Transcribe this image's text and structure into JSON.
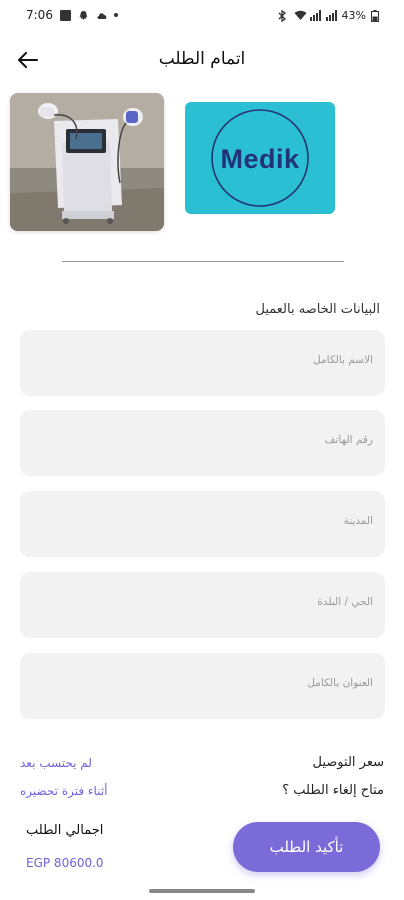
{
  "status_bar": {
    "time": "7:06",
    "battery": "43%"
  },
  "app_bar": {
    "title": "اتمام الطلب",
    "back_icon": "arrow-left-icon"
  },
  "product": {
    "brand_logo_text": "Medik"
  },
  "form": {
    "section_title": "البيانات الخاصه بالعميل",
    "fields": [
      {
        "placeholder": "الاسم بالكامل"
      },
      {
        "placeholder": "رقم الهاتف"
      },
      {
        "placeholder": "المدينة"
      },
      {
        "placeholder": "الحي / البلدة"
      },
      {
        "placeholder": "العنوان بالكامل"
      }
    ]
  },
  "info": {
    "shipping_label": "سعر التوصيل",
    "shipping_value": "لم يحتسب بعد",
    "cancel_label": "متاح إلغاء الطلب ؟",
    "cancel_value": "أثناء فترة تحضيره"
  },
  "summary": {
    "total_label": "اجمالي الطلب",
    "total_value": "EGP 80600.0",
    "confirm_label": "تأكيد الطلب"
  },
  "colors": {
    "accent": "#7a6bd8",
    "link": "#6c63d9",
    "brand_bg": "#2bbfd4",
    "brand_text": "#23337a",
    "field_bg": "#f2f2f2"
  }
}
